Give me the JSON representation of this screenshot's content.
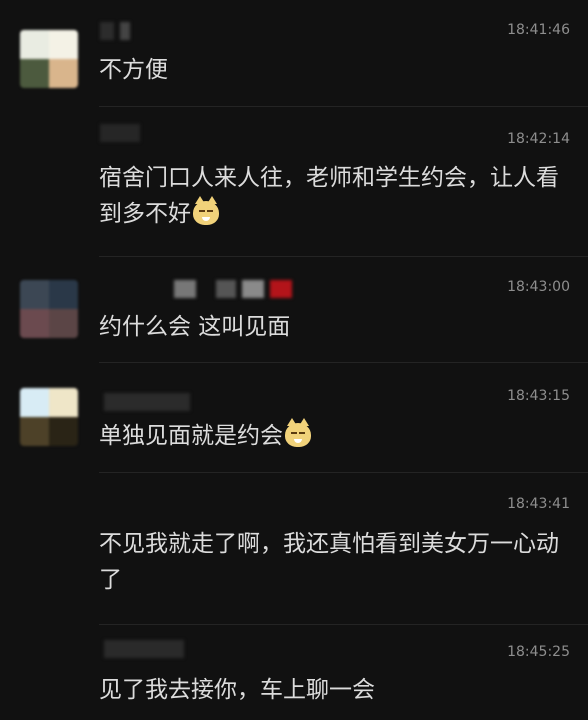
{
  "messages": [
    {
      "time": "18:41:46",
      "text": "不方便"
    },
    {
      "time": "18:42:14",
      "text": "宿舍门口人来人往，老师和学生约会，让人看到多不好"
    },
    {
      "time": "18:43:00",
      "text": "约什么会  这叫见面"
    },
    {
      "time": "18:43:15",
      "text": "单独见面就是约会"
    },
    {
      "time": "18:43:41",
      "text": "不见我就走了啊，我还真怕看到美女万一心动了"
    },
    {
      "time": "18:45:25",
      "text": "见了我去接你，车上聊一会"
    }
  ],
  "icons": {
    "emoji": "smirking-cat-emoji-icon"
  }
}
